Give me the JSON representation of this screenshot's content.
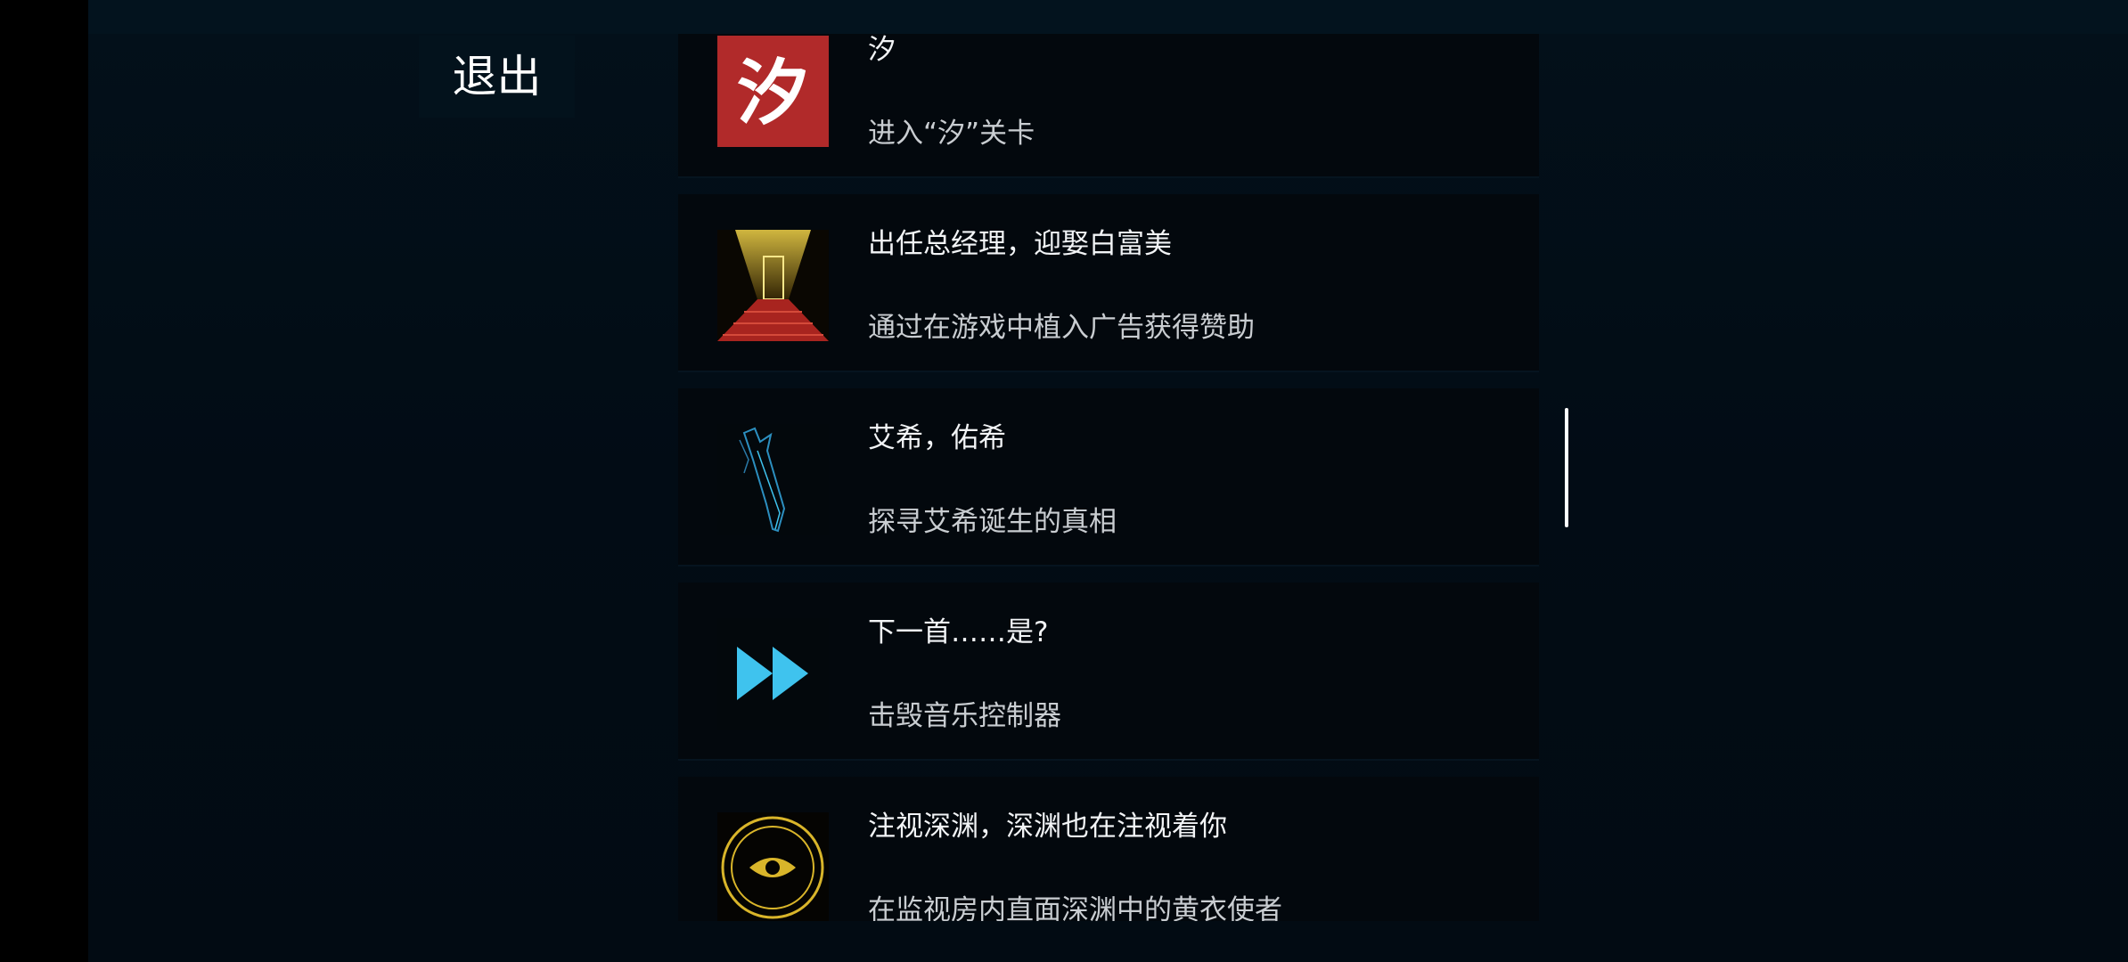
{
  "exit_label": "退出",
  "achievements": [
    {
      "title": "汐",
      "desc": "进入“汐”关卡",
      "icon": "xi-character-icon",
      "icon_glyph": "汐"
    },
    {
      "title": "出任总经理，迎娶白富美",
      "desc": "通过在游戏中植入广告获得赞助",
      "icon": "red-carpet-door-icon"
    },
    {
      "title": "艾希，佑希",
      "desc": "探寻艾希诞生的真相",
      "icon": "sword-icon"
    },
    {
      "title": "下一首……是?",
      "desc": "击毁音乐控制器",
      "icon": "fast-forward-icon"
    },
    {
      "title": "注视深渊，深渊也在注视着你",
      "desc": "在监视房内直面深渊中的黄衣使者",
      "icon": "eye-seal-icon"
    }
  ],
  "colors": {
    "accent_cyan": "#3fc3ee",
    "gold": "#d9b52a",
    "red": "#b42a2a"
  }
}
